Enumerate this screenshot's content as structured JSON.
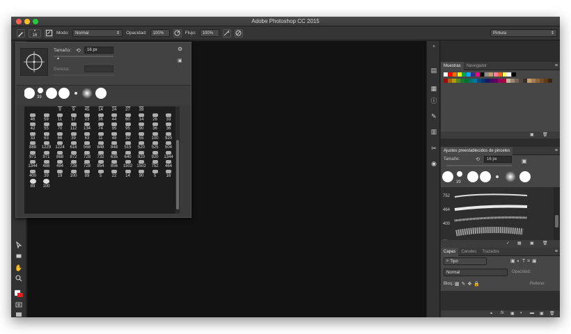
{
  "window": {
    "title": "Adobe Photoshop CC 2015"
  },
  "optionsbar": {
    "brush_size": "16",
    "mode_label": "Modo:",
    "mode_value": "Normal",
    "opacity_label": "Opacidad:",
    "opacity_value": "100%",
    "flow_label": "Flujo:",
    "flow_value": "100%",
    "workspace": "Pintura"
  },
  "brush_picker": {
    "size_label": "Tamaño:",
    "size_value": "16 px",
    "hardness_label": "Dureza:",
    "preview_size": "39",
    "grid_labels": [
      "9",
      "9",
      "45",
      "14",
      "24",
      "27",
      "39",
      "46",
      "59",
      "11",
      "17",
      "23",
      "36",
      "44",
      "60",
      "14",
      "26",
      "33",
      "42",
      "55",
      "70",
      "112",
      "134",
      "74",
      "95",
      "95",
      "90",
      "36",
      "36",
      "33",
      "63",
      "66",
      "39",
      "63",
      "11",
      "48",
      "32",
      "55",
      "100",
      "920",
      "888",
      "1229",
      "1224",
      "616",
      "568",
      "848",
      "848",
      "515",
      "520",
      "525",
      "504",
      "971",
      "971",
      "868",
      "872",
      "728",
      "732",
      "635",
      "640",
      "920",
      "920",
      "1344",
      "1344",
      "488",
      "494",
      "728",
      "728",
      "854",
      "856",
      "1502",
      "1502",
      "752",
      "464",
      "400",
      "39",
      "19",
      "100",
      "89",
      "5",
      "22",
      "14",
      "90",
      "5",
      "16",
      "89",
      "100"
    ]
  },
  "panels": {
    "swatches_tab": "Muestras",
    "navigator_tab": "Navegador",
    "brush_presets_title": "Ajustes preestablecidos de pinceles",
    "brush_presets_size_label": "Tamaño:",
    "brush_presets_size_value": "16 px",
    "brush_presets_preview_size": "39",
    "preset_strokes": [
      "752",
      "464",
      "400",
      "39"
    ],
    "layers_tab": "Capas",
    "channels_tab": "Canales",
    "paths_tab": "Trazados",
    "layer_filter": "Tipo",
    "blend_mode": "Normal",
    "opacity_label": "Opacidad:",
    "lock_label": "Bloq.:",
    "fill_label": "Relleno:"
  },
  "colors": {
    "close": "#ff5f57",
    "minimize": "#ffbd2e",
    "maximize": "#28c940",
    "canvas": "#121212",
    "panel": "#464646"
  },
  "swatches_row1": [
    "#ffffff",
    "#ff0000",
    "#ff6a00",
    "#fff200",
    "#00a651",
    "#00aeef",
    "#2e3192",
    "#ec008c",
    "#000000",
    "#8c8c8c",
    "#c69c6d",
    "#ff7b9c",
    "#f26522",
    "#ffff66",
    "#ffffff",
    "#000000"
  ],
  "swatches_row2": [
    "#9e0b0f",
    "#a3620a",
    "#aba000",
    "#598527",
    "#1a7b30",
    "#007236",
    "#00746b",
    "#0076a3",
    "#004a80",
    "#003471",
    "#1b1464",
    "#440e62",
    "#630460",
    "#9e005d",
    "#9e0039",
    "#c7b299",
    "#998675",
    "#736357",
    "#534741",
    "#37302a",
    "#c69c6d",
    "#a67c52",
    "#8c6239",
    "#754c24",
    "#603913",
    "#3c2415"
  ]
}
